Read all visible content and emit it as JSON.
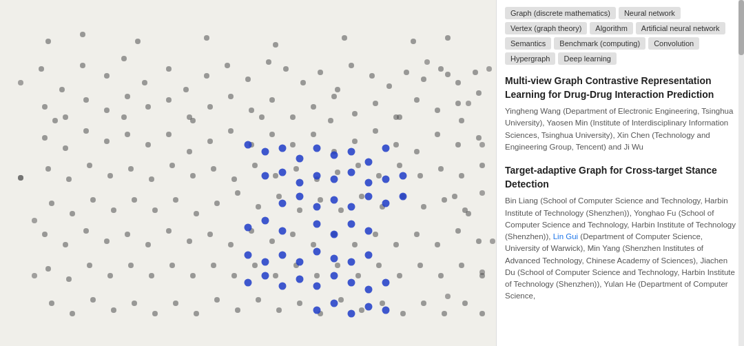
{
  "tags": [
    "Graph (discrete mathematics)",
    "Neural network",
    "Vertex (graph theory)",
    "Algorithm",
    "Artificial neural network",
    "Semantics",
    "Benchmark (computing)",
    "Convolution",
    "Hypergraph",
    "Deep learning"
  ],
  "papers": [
    {
      "title": "Multi-view Graph Contrastive Representation Learning for Drug-Drug Interaction Prediction",
      "authors": "Yingheng Wang (Department of Electronic Engineering, Tsinghua University), Yaosen Min (Institute of Interdisciplinary Information Sciences, Tsinghua University), Xin Chen (Technology and Engineering Group, Tencent) and Ji Wu"
    },
    {
      "title": "Target-adaptive Graph for Cross-target Stance Detection",
      "authors": "Bin Liang (School of Computer Science and Technology, Harbin Institute of Technology (Shenzhen)), Yonghao Fu (School of Computer Science and Technology, Harbin Institute of Technology (Shenzhen)), Lin Gui (Department of Computer Science, University of Warwick), Min Yang (Shenzhen Institutes of Advanced Technology, Chinese Academy of Sciences), Jiachen Du (School of Computer Science and Technology, Harbin Institute of Technology (Shenzhen)), Yulan He (Department of Computer Science,"
    }
  ],
  "scatter": {
    "gray_dots": [
      [
        60,
        100
      ],
      [
        90,
        130
      ],
      [
        120,
        95
      ],
      [
        155,
        110
      ],
      [
        180,
        85
      ],
      [
        210,
        120
      ],
      [
        245,
        100
      ],
      [
        270,
        130
      ],
      [
        300,
        110
      ],
      [
        330,
        95
      ],
      [
        360,
        115
      ],
      [
        390,
        90
      ],
      [
        415,
        100
      ],
      [
        440,
        120
      ],
      [
        465,
        105
      ],
      [
        490,
        130
      ],
      [
        510,
        95
      ],
      [
        540,
        110
      ],
      [
        565,
        125
      ],
      [
        590,
        105
      ],
      [
        615,
        115
      ],
      [
        640,
        100
      ],
      [
        665,
        120
      ],
      [
        690,
        105
      ],
      [
        65,
        155
      ],
      [
        95,
        170
      ],
      [
        125,
        145
      ],
      [
        155,
        160
      ],
      [
        185,
        140
      ],
      [
        215,
        155
      ],
      [
        245,
        145
      ],
      [
        275,
        170
      ],
      [
        305,
        155
      ],
      [
        335,
        140
      ],
      [
        365,
        160
      ],
      [
        395,
        145
      ],
      [
        425,
        170
      ],
      [
        455,
        155
      ],
      [
        485,
        140
      ],
      [
        515,
        165
      ],
      [
        545,
        150
      ],
      [
        575,
        170
      ],
      [
        605,
        145
      ],
      [
        635,
        160
      ],
      [
        665,
        150
      ],
      [
        695,
        135
      ],
      [
        65,
        200
      ],
      [
        95,
        215
      ],
      [
        125,
        190
      ],
      [
        155,
        205
      ],
      [
        185,
        195
      ],
      [
        215,
        210
      ],
      [
        245,
        195
      ],
      [
        275,
        220
      ],
      [
        305,
        205
      ],
      [
        335,
        190
      ],
      [
        365,
        210
      ],
      [
        395,
        195
      ],
      [
        425,
        210
      ],
      [
        455,
        195
      ],
      [
        485,
        220
      ],
      [
        515,
        205
      ],
      [
        545,
        190
      ],
      [
        575,
        210
      ],
      [
        605,
        220
      ],
      [
        635,
        195
      ],
      [
        665,
        210
      ],
      [
        695,
        200
      ],
      [
        70,
        245
      ],
      [
        100,
        260
      ],
      [
        130,
        240
      ],
      [
        160,
        255
      ],
      [
        190,
        245
      ],
      [
        220,
        260
      ],
      [
        250,
        240
      ],
      [
        280,
        255
      ],
      [
        310,
        245
      ],
      [
        340,
        260
      ],
      [
        370,
        240
      ],
      [
        400,
        255
      ],
      [
        430,
        245
      ],
      [
        460,
        260
      ],
      [
        490,
        250
      ],
      [
        520,
        240
      ],
      [
        550,
        255
      ],
      [
        580,
        240
      ],
      [
        610,
        255
      ],
      [
        640,
        245
      ],
      [
        670,
        255
      ],
      [
        700,
        240
      ],
      [
        75,
        295
      ],
      [
        105,
        310
      ],
      [
        135,
        290
      ],
      [
        165,
        305
      ],
      [
        195,
        290
      ],
      [
        225,
        305
      ],
      [
        255,
        290
      ],
      [
        285,
        310
      ],
      [
        315,
        295
      ],
      [
        345,
        280
      ],
      [
        375,
        300
      ],
      [
        405,
        285
      ],
      [
        435,
        305
      ],
      [
        465,
        290
      ],
      [
        495,
        305
      ],
      [
        525,
        285
      ],
      [
        555,
        300
      ],
      [
        585,
        285
      ],
      [
        615,
        300
      ],
      [
        645,
        290
      ],
      [
        675,
        305
      ],
      [
        65,
        340
      ],
      [
        95,
        355
      ],
      [
        125,
        335
      ],
      [
        155,
        350
      ],
      [
        185,
        340
      ],
      [
        215,
        355
      ],
      [
        245,
        335
      ],
      [
        275,
        350
      ],
      [
        305,
        340
      ],
      [
        335,
        355
      ],
      [
        365,
        335
      ],
      [
        395,
        350
      ],
      [
        425,
        340
      ],
      [
        455,
        355
      ],
      [
        485,
        340
      ],
      [
        515,
        355
      ],
      [
        545,
        340
      ],
      [
        575,
        355
      ],
      [
        605,
        340
      ],
      [
        635,
        355
      ],
      [
        665,
        335
      ],
      [
        695,
        350
      ],
      [
        70,
        390
      ],
      [
        100,
        405
      ],
      [
        130,
        385
      ],
      [
        160,
        400
      ],
      [
        190,
        385
      ],
      [
        220,
        400
      ],
      [
        250,
        385
      ],
      [
        280,
        400
      ],
      [
        310,
        385
      ],
      [
        340,
        400
      ],
      [
        370,
        385
      ],
      [
        400,
        400
      ],
      [
        430,
        385
      ],
      [
        460,
        400
      ],
      [
        490,
        385
      ],
      [
        520,
        400
      ],
      [
        550,
        385
      ],
      [
        580,
        400
      ],
      [
        610,
        385
      ],
      [
        640,
        400
      ],
      [
        670,
        385
      ],
      [
        700,
        400
      ],
      [
        75,
        440
      ],
      [
        105,
        455
      ],
      [
        135,
        435
      ],
      [
        165,
        450
      ],
      [
        195,
        440
      ],
      [
        225,
        455
      ],
      [
        255,
        440
      ],
      [
        285,
        455
      ],
      [
        315,
        435
      ],
      [
        345,
        450
      ],
      [
        375,
        435
      ],
      [
        405,
        450
      ],
      [
        435,
        440
      ],
      [
        465,
        455
      ],
      [
        495,
        435
      ],
      [
        525,
        450
      ],
      [
        555,
        440
      ],
      [
        585,
        455
      ],
      [
        615,
        440
      ],
      [
        645,
        455
      ],
      [
        675,
        440
      ],
      [
        700,
        455
      ],
      [
        30,
        258
      ],
      [
        650,
        108
      ],
      [
        660,
        285
      ],
      [
        680,
        310
      ],
      [
        70,
        60
      ],
      [
        120,
        50
      ],
      [
        200,
        60
      ],
      [
        300,
        55
      ],
      [
        400,
        65
      ],
      [
        500,
        55
      ],
      [
        600,
        60
      ],
      [
        650,
        55
      ],
      [
        80,
        175
      ],
      [
        180,
        170
      ],
      [
        280,
        175
      ],
      [
        380,
        170
      ],
      [
        480,
        175
      ],
      [
        580,
        170
      ],
      [
        670,
        175
      ]
    ],
    "blue_dots": [
      [
        360,
        210
      ],
      [
        385,
        220
      ],
      [
        410,
        215
      ],
      [
        435,
        230
      ],
      [
        460,
        215
      ],
      [
        485,
        225
      ],
      [
        510,
        220
      ],
      [
        535,
        235
      ],
      [
        560,
        215
      ],
      [
        385,
        255
      ],
      [
        410,
        250
      ],
      [
        435,
        265
      ],
      [
        460,
        255
      ],
      [
        485,
        260
      ],
      [
        510,
        250
      ],
      [
        535,
        265
      ],
      [
        560,
        260
      ],
      [
        585,
        255
      ],
      [
        410,
        295
      ],
      [
        435,
        285
      ],
      [
        460,
        300
      ],
      [
        485,
        290
      ],
      [
        510,
        300
      ],
      [
        535,
        285
      ],
      [
        560,
        295
      ],
      [
        585,
        285
      ],
      [
        360,
        330
      ],
      [
        385,
        320
      ],
      [
        410,
        335
      ],
      [
        460,
        325
      ],
      [
        485,
        340
      ],
      [
        510,
        325
      ],
      [
        535,
        335
      ],
      [
        360,
        370
      ],
      [
        385,
        380
      ],
      [
        410,
        370
      ],
      [
        435,
        380
      ],
      [
        460,
        365
      ],
      [
        485,
        375
      ],
      [
        510,
        380
      ],
      [
        535,
        370
      ],
      [
        360,
        410
      ],
      [
        385,
        400
      ],
      [
        410,
        415
      ],
      [
        435,
        405
      ],
      [
        460,
        415
      ],
      [
        485,
        400
      ],
      [
        510,
        410
      ],
      [
        535,
        420
      ],
      [
        560,
        410
      ],
      [
        460,
        450
      ],
      [
        485,
        440
      ],
      [
        510,
        455
      ],
      [
        535,
        445
      ],
      [
        560,
        450
      ]
    ]
  }
}
